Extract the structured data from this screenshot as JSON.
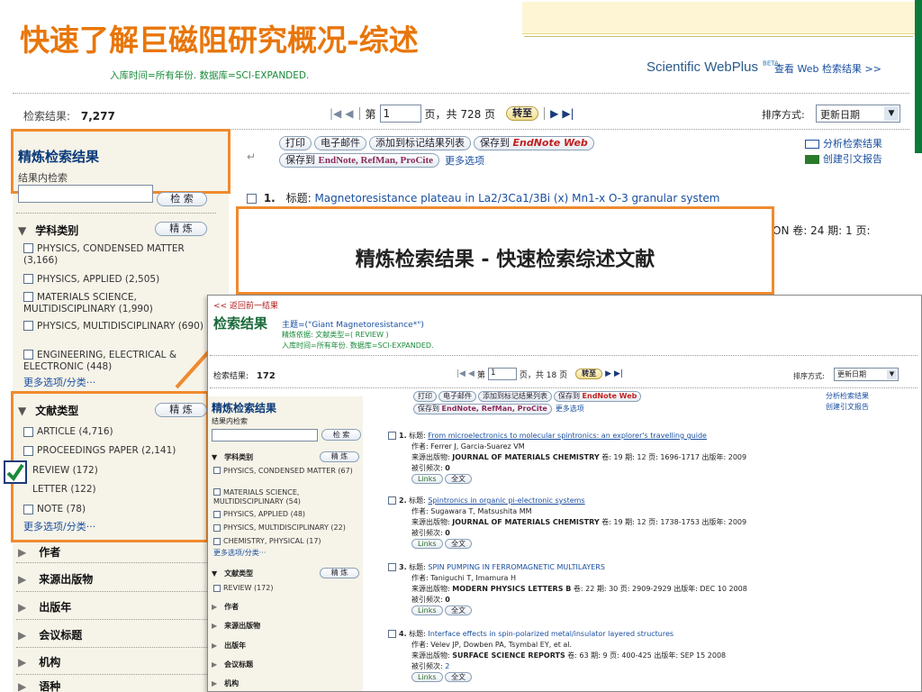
{
  "slide": {
    "title": "快速了解巨磁阻研究概况-综述",
    "callout": "精炼检索结果 - 快速检索综述文献"
  },
  "header": {
    "query_info": "入库时间=所有年份. 数据库=SCI-EXPANDED.",
    "brand": "Scientific WebPlus",
    "brand_beta": "BETA",
    "web_results_link": "查看 Web 检索结果 >>"
  },
  "results_bar": {
    "label": "检索结果:",
    "count": "7,277",
    "page_prefix": "第",
    "page_value": "1",
    "page_suffix": "页，共 728 页",
    "go_label": "转至",
    "sort_label": "排序方式:",
    "sort_value": "更新日期"
  },
  "toolbar": {
    "print": "打印",
    "email": "电子邮件",
    "add_marked": "添加到标记结果列表",
    "save_to": "保存到",
    "save_to_brand": "EndNote Web",
    "save_to2": "保存到",
    "save_to2_brands": "EndNote, RefMan, ProCite",
    "more_options": "更多选项",
    "analyze": "分析检索结果",
    "citation_report": "创建引文报告"
  },
  "sidebar": {
    "title": "精炼检索结果",
    "within_label": "结果内检索",
    "search_btn": "检 索",
    "refine_btn": "精 炼",
    "subject_heading": "学科类别",
    "subjects": [
      "PHYSICS, CONDENSED MATTER (3,166)",
      "PHYSICS, APPLIED (2,505)",
      "MATERIALS SCIENCE, MULTIDISCIPLINARY (1,990)",
      "PHYSICS, MULTIDISCIPLINARY (690)",
      "ENGINEERING, ELECTRICAL & ELECTRONIC (448)"
    ],
    "more_link": "更多选项/分类···",
    "doctype_heading": "文献类型",
    "doctypes": [
      "ARTICLE (4,716)",
      "PROCEEDINGS PAPER (2,141)",
      "REVIEW (172)",
      "LETTER (122)",
      "NOTE (78)"
    ],
    "more_link2": "更多选项/分类···",
    "collapsed": [
      "作者",
      "来源出版物",
      "出版年",
      "会议标题",
      "机构",
      "语种"
    ]
  },
  "record1": {
    "num": "1.",
    "label": "标题:",
    "title": "Magnetoresistance plateau in La2/3Ca1/3Bi (x) Mn1-x O-3 granular system",
    "partial": "ON  卷: 24  期: 1  页:"
  },
  "inset": {
    "back_link": "<< 返回前一结果",
    "heading": "检索结果",
    "topic": "主题=(\"Giant Magnetoresistance*\")",
    "refined_by": "精炼依据: 文献类型=( REVIEW )",
    "timespan": "入库时间=所有年份. 数据库=SCI-EXPANDED.",
    "count_label": "检索结果:",
    "count": "172",
    "page_prefix": "第",
    "page_value": "1",
    "page_suffix": "页，共 18 页",
    "go_label": "转至",
    "sort_label": "排序方式:",
    "sort_value": "更新日期",
    "side_title": "精炼检索结果",
    "side_within": "结果内检索",
    "side_search": "检 索",
    "side_refine": "精 炼",
    "side_subject": "学科类别",
    "side_subjects": [
      "PHYSICS, CONDENSED MATTER (67)",
      "MATERIALS SCIENCE, MULTIDISCIPLINARY (54)",
      "PHYSICS, APPLIED (48)",
      "PHYSICS, MULTIDISCIPLINARY (22)",
      "CHEMISTRY, PHYSICAL (17)"
    ],
    "side_more": "更多选项/分类···",
    "side_doctype": "文献类型",
    "side_review": "REVIEW (172)",
    "side_collapsed": [
      "作者",
      "来源出版物",
      "出版年",
      "会议标题",
      "机构"
    ],
    "records": [
      {
        "num": "1.",
        "title": "From microelectronics to molecular spintronics: an explorer's travelling guide",
        "authors": "作者: Ferrer J, Garcia-Suarez VM",
        "source_label": "来源出版物:",
        "source": "JOURNAL OF MATERIALS CHEMISTRY",
        "details": "卷: 19  期: 12  页: 1696-1717  出版年: 2009",
        "cited_label": "被引频次:",
        "cited": "0"
      },
      {
        "num": "2.",
        "title": "Spintronics in organic pi-electronic systems",
        "authors": "作者: Sugawara T, Matsushita MM",
        "source_label": "来源出版物:",
        "source": "JOURNAL OF MATERIALS CHEMISTRY",
        "details": "卷: 19  期: 12  页: 1738-1753  出版年: 2009",
        "cited_label": "被引频次:",
        "cited": "0"
      },
      {
        "num": "3.",
        "title": "SPIN PUMPING IN FERROMAGNETIC MULTILAYERS",
        "authors": "作者: Taniguchi T, Imamura H",
        "source_label": "来源出版物:",
        "source": "MODERN PHYSICS LETTERS B",
        "details": "卷: 22  期: 30  页: 2909-2929  出版年: DEC 10 2008",
        "cited_label": "被引频次:",
        "cited": "0"
      },
      {
        "num": "4.",
        "title": "Interface effects in spin-polarized metal/insulator layered structures",
        "authors": "作者: Velev JP, Dowben PA, Tsymbal EY, et al.",
        "source_label": "来源出版物:",
        "source": "SURFACE SCIENCE REPORTS",
        "details": "卷: 63  期: 9  页: 400-425  出版年: SEP 15 2008",
        "cited_label": "被引频次:",
        "cited": "2"
      }
    ],
    "links_btn": "Links",
    "fulltext_btn": "全文",
    "analyze": "分析检索结果",
    "citation_report": "创建引文报告"
  },
  "colors": {
    "orange": "#f08a2e",
    "title_orange": "#e8760a",
    "link_blue": "#1a4fa0",
    "check_green": "#1a8a3a"
  }
}
